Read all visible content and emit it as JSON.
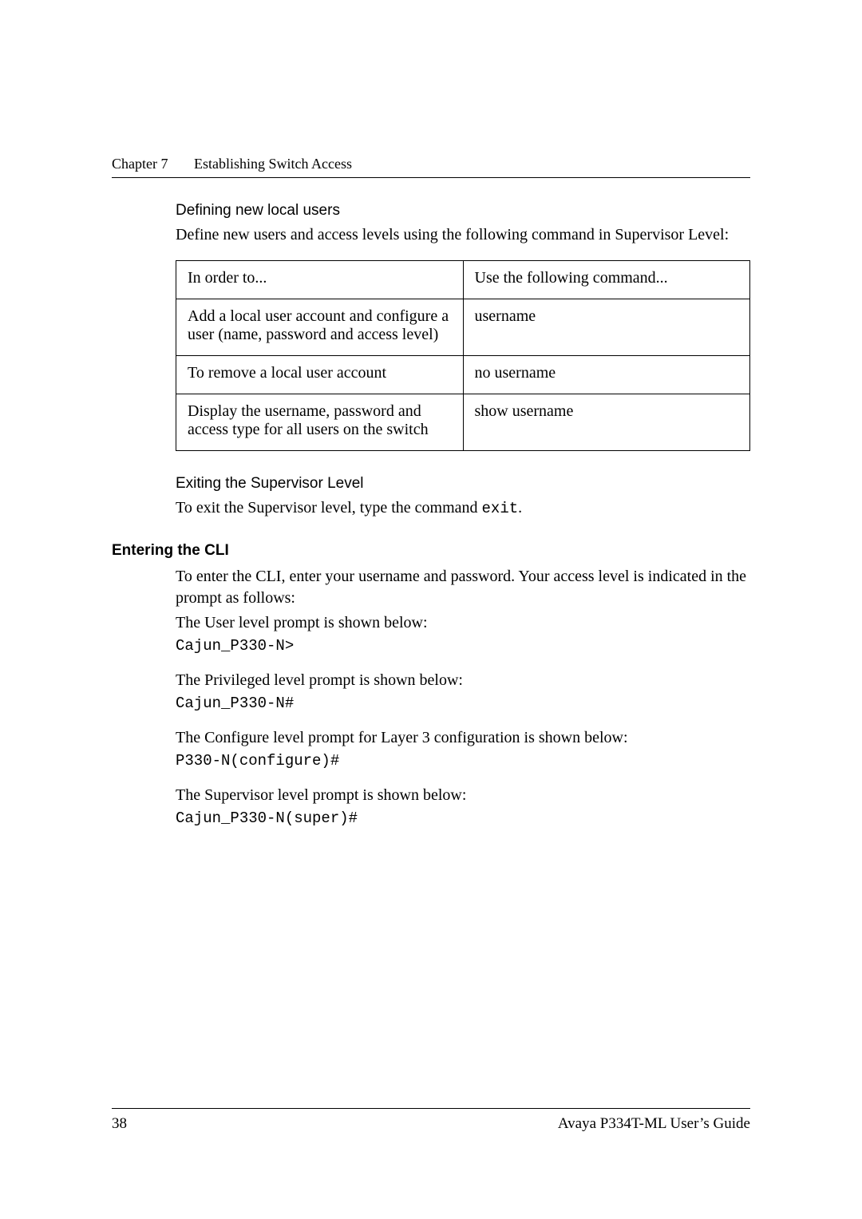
{
  "header": {
    "chapter": "Chapter 7",
    "title": "Establishing Switch Access"
  },
  "sec_define": {
    "heading": "Defining new local users",
    "intro": "Define new users and access levels using the following command in Supervisor Level:"
  },
  "table": {
    "head": {
      "c1": "In order to...",
      "c2": "Use the following command..."
    },
    "rows": [
      {
        "c1": "Add a local user account and configure a user (name, password and access level)",
        "c2": "username"
      },
      {
        "c1": "To remove a local user account",
        "c2": "no username"
      },
      {
        "c1": "Display the username, password and access type for all users on the switch",
        "c2": "show username"
      }
    ]
  },
  "sec_exit": {
    "heading": "Exiting the Supervisor Level",
    "text_pre": "To exit the Supervisor level, type the command ",
    "cmd": "exit",
    "text_post": "."
  },
  "sec_cli": {
    "heading": "Entering the CLI",
    "intro": "To enter the CLI, enter your username and password. Your access level is indicated in the prompt as follows:",
    "lines": [
      {
        "text": "The User level prompt is shown below:"
      },
      {
        "mono": "Cajun_P330-N>"
      },
      {
        "text": "The Privileged level prompt is shown below:"
      },
      {
        "mono": "Cajun_P330-N#"
      },
      {
        "text": "The Configure level prompt for Layer 3 configuration is shown below:"
      },
      {
        "mono": "P330-N(configure)#"
      },
      {
        "text": "The Supervisor level prompt is shown below:"
      },
      {
        "mono": "Cajun_P330-N(super)#"
      }
    ]
  },
  "footer": {
    "page": "38",
    "guide": "Avaya P334T-ML User’s Guide"
  }
}
